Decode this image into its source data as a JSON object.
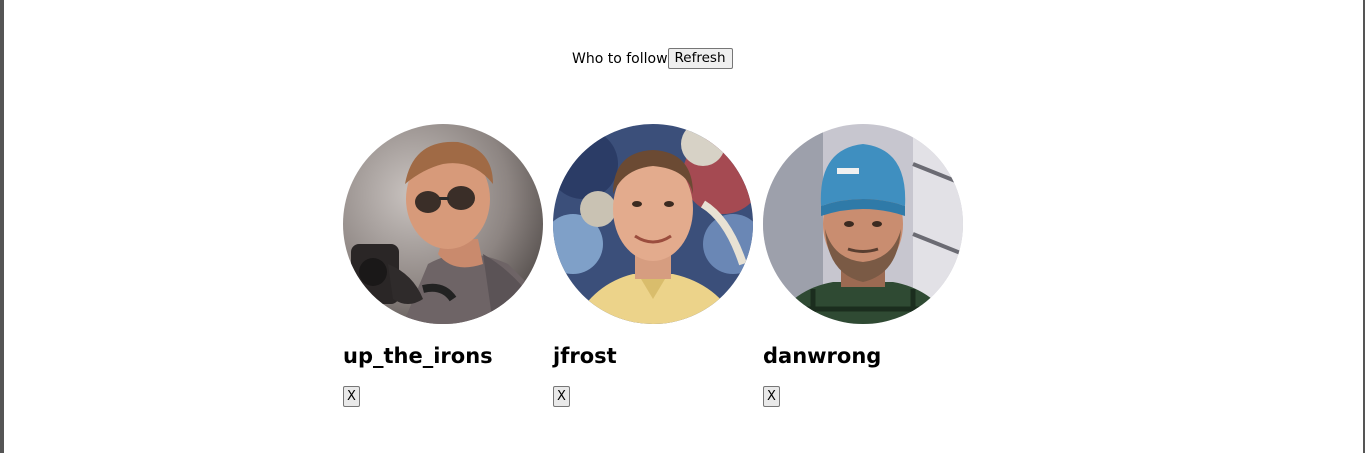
{
  "header": {
    "title": "Who to follow",
    "refresh_label": "Refresh"
  },
  "suggestions": [
    {
      "username": "up_the_irons",
      "dismiss_label": "X"
    },
    {
      "username": "jfrost",
      "dismiss_label": "X"
    },
    {
      "username": "danwrong",
      "dismiss_label": "X"
    }
  ]
}
